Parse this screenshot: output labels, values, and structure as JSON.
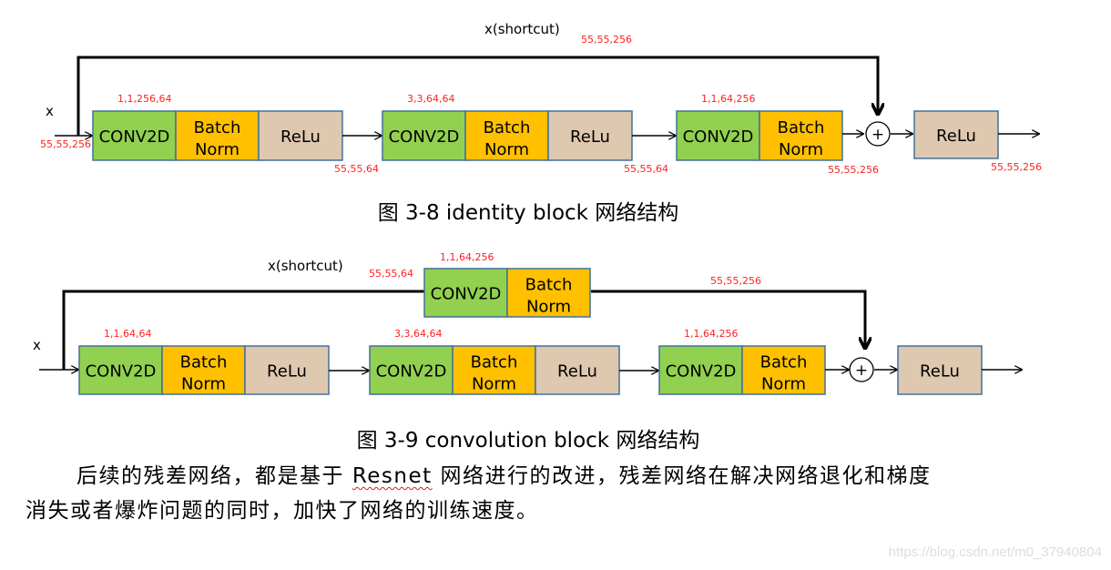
{
  "colors": {
    "conv": "#92d050",
    "bn": "#ffc000",
    "relu": "#dfc8b0",
    "box_border": "#41719c",
    "dim_label": "#ff2020",
    "line": "#000000"
  },
  "identity_block": {
    "caption": "图 3-8 identity block 网络结构",
    "input_label": "x",
    "input_dims": "55,55,256",
    "shortcut_label": "x(shortcut)",
    "shortcut_dims": "55,55,256",
    "stages": [
      {
        "conv": "CONV2D",
        "bn": "Batch Norm",
        "relu": "ReLu",
        "kernel": "1,1,256,64",
        "output_dims": "55,55,64"
      },
      {
        "conv": "CONV2D",
        "bn": "Batch Norm",
        "relu": "ReLu",
        "kernel": "3,3,64,64",
        "output_dims": "55,55,64"
      },
      {
        "conv": "CONV2D",
        "bn": "Batch Norm",
        "relu": null,
        "kernel": "1,1,64,256",
        "output_dims": "55,55,256"
      }
    ],
    "add_symbol": "+",
    "final_relu": "ReLu",
    "final_dims": "55,55,256"
  },
  "conv_block": {
    "caption": "图 3-9 convolution block 网络结构",
    "input_label": "x",
    "shortcut_label": "x(shortcut)",
    "shortcut_in_dims": "55,55,64",
    "shortcut_out_dims": "55,55,256",
    "shortcut_stage": {
      "conv": "CONV2D",
      "bn": "Batch Norm",
      "kernel": "1,1,64,256"
    },
    "stages": [
      {
        "conv": "CONV2D",
        "bn": "Batch Norm",
        "relu": "ReLu",
        "kernel": "1,1,64,64"
      },
      {
        "conv": "CONV2D",
        "bn": "Batch Norm",
        "relu": "ReLu",
        "kernel": "3,3,64,64"
      },
      {
        "conv": "CONV2D",
        "bn": "Batch Norm",
        "relu": null,
        "kernel": "1,1,64,256"
      }
    ],
    "add_symbol": "+",
    "final_relu": "ReLu"
  },
  "paragraph": {
    "line1_before": "后续的残差网络，都是基于 ",
    "line1_keyword": "Resnet",
    "line1_after": " 网络进行的改进，残差网络在解决网络退化和梯度",
    "line2": "消失或者爆炸问题的同时，加快了网络的训练速度。"
  },
  "watermark": "https://blog.csdn.net/m0_37940804"
}
